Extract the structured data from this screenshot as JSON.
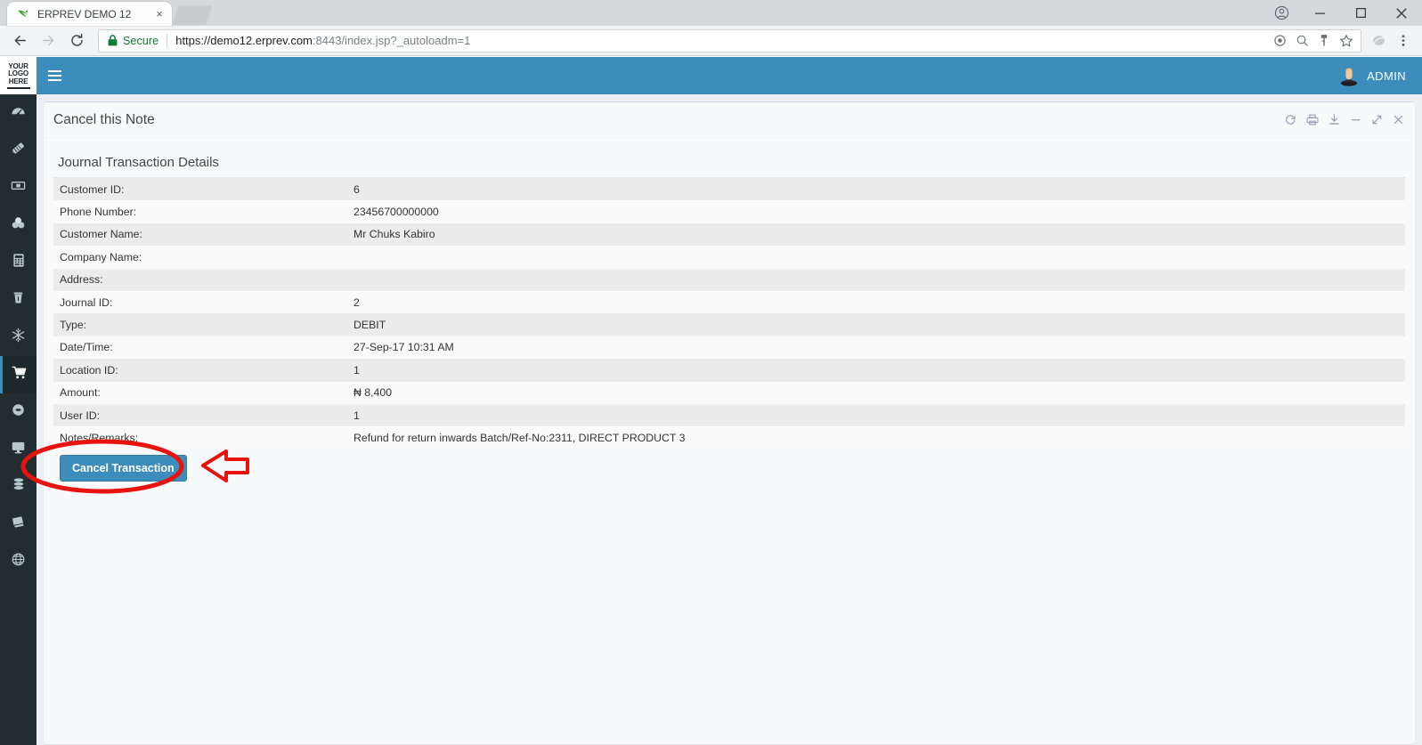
{
  "browser": {
    "tab": {
      "title": "ERPREV DEMO 12",
      "favicon": "erprev-leaf-icon",
      "close": "×"
    },
    "newtab_label": "",
    "window_controls": {
      "profile": "profile-icon",
      "minimize": "—",
      "maximize": "❐",
      "close": "✕"
    },
    "nav": {
      "back": "←",
      "forward": "→",
      "reload": "⟳"
    },
    "omnibox": {
      "security_label": "Secure",
      "url_main": "https://demo12.erprev.com",
      "url_dim": ":8443",
      "url_rest": "/index.jsp?_autoloadm=1",
      "icons": [
        "target-icon",
        "search-icon",
        "key-icon",
        "star-icon"
      ]
    },
    "toolbar_right": {
      "extension": "extension-icon",
      "menu": "⋮"
    }
  },
  "app": {
    "logo": {
      "line1": "YOUR",
      "line2": "LOGO",
      "line3": "HERE"
    },
    "navbar": {
      "user": "ADMIN",
      "avatar": "user-avatar-icon",
      "menu_toggle": "hamburger-icon"
    },
    "sidebar": {
      "items": [
        {
          "icon": "dashboard-gauge-icon",
          "active": false
        },
        {
          "icon": "tags-icon",
          "active": false
        },
        {
          "icon": "banknote-icon",
          "active": false
        },
        {
          "icon": "coins-icon",
          "active": false
        },
        {
          "icon": "calculator-icon",
          "active": false
        },
        {
          "icon": "trash-bin-icon",
          "active": false
        },
        {
          "icon": "snowflake-icon",
          "active": false
        },
        {
          "icon": "shopping-cart-icon",
          "active": true
        },
        {
          "icon": "disc-icon",
          "active": false
        },
        {
          "icon": "desktop-monitor-icon",
          "active": false
        },
        {
          "icon": "database-icon",
          "active": false
        },
        {
          "icon": "book-icon",
          "active": false
        },
        {
          "icon": "globe-icon",
          "active": false
        }
      ]
    },
    "panel": {
      "title": "Cancel this Note",
      "tools": [
        {
          "name": "refresh-icon",
          "glyph": "⟳"
        },
        {
          "name": "print-icon",
          "glyph": "⎙"
        },
        {
          "name": "download-icon",
          "glyph": "⤓"
        },
        {
          "name": "minimize-icon",
          "glyph": "−"
        },
        {
          "name": "expand-icon",
          "glyph": "↗"
        },
        {
          "name": "close-icon",
          "glyph": "✕"
        }
      ],
      "section_title": "Journal Transaction Details",
      "rows": [
        {
          "label": "Customer ID:",
          "value": "6"
        },
        {
          "label": "Phone Number:",
          "value": "23456700000000"
        },
        {
          "label": "Customer Name:",
          "value": "Mr Chuks Kabiro"
        },
        {
          "label": "Company Name:",
          "value": ""
        },
        {
          "label": "Address:",
          "value": ""
        },
        {
          "label": "Journal ID:",
          "value": "2"
        },
        {
          "label": "Type:",
          "value": "DEBIT"
        },
        {
          "label": "Date/Time:",
          "value": "27-Sep-17 10:31 AM"
        },
        {
          "label": "Location ID:",
          "value": "1"
        },
        {
          "label": "Amount:",
          "value": "₦ 8,400"
        },
        {
          "label": "User ID:",
          "value": "1"
        },
        {
          "label": "Notes/Remarks:",
          "value": "Refund for return inwards Batch/Ref-No:2311, DIRECT PRODUCT 3"
        }
      ],
      "cancel_button": "Cancel Transaction"
    },
    "annotation": {
      "color": "#e8120f",
      "shapes": [
        "ellipse-highlight",
        "left-arrow-pointer"
      ]
    }
  },
  "colors": {
    "brand_blue": "#3c8dbc",
    "sidebar_dark": "#222d32",
    "app_bg": "#ecf0f5",
    "row_odd": "#ececec",
    "row_even": "#fafafa",
    "annotation_red": "#e8120f",
    "secure_green": "#0b7a34"
  }
}
